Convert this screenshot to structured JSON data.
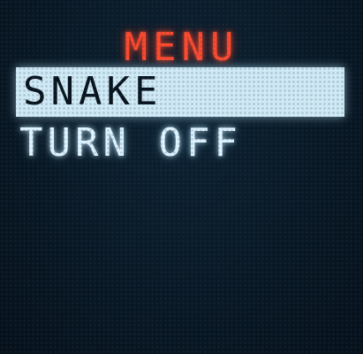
{
  "menu": {
    "title": "MENU",
    "items": [
      {
        "label": "SNAKE",
        "selected": true
      },
      {
        "label": "TURN OFF",
        "selected": false
      }
    ]
  },
  "colors": {
    "title": "#ff4a2e",
    "selected_bg": "#cfe9f5",
    "text": "#dff3ff",
    "screen_bg": "#07111a"
  }
}
